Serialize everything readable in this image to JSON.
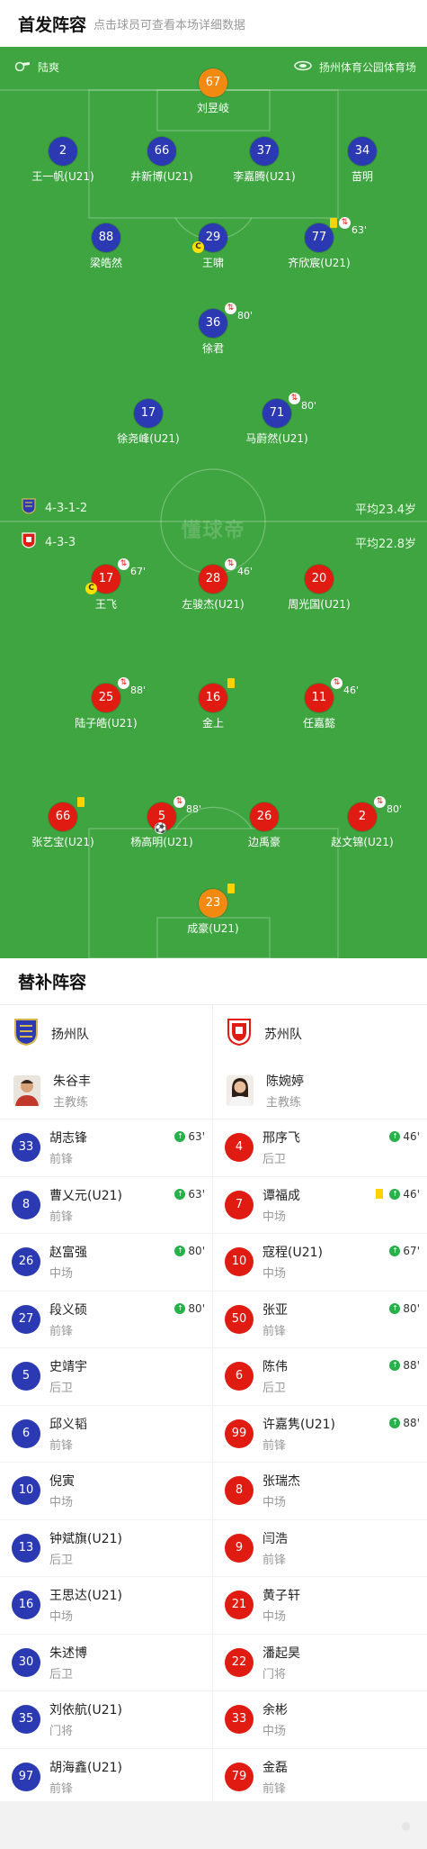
{
  "header": {
    "title": "首发阵容",
    "subtitle": "点击球员可查看本场详细数据"
  },
  "match": {
    "referee": "陆爽",
    "venue": "扬州体育公园体育场",
    "watermark": "懂球帝"
  },
  "home": {
    "formation": "4-3-1-2",
    "avg_age": "平均23.4岁",
    "team_name": "扬州队",
    "coach_name": "朱谷丰",
    "coach_role": "主教练",
    "players": [
      {
        "num": "67",
        "name": "刘昱岐",
        "kit": "gk"
      },
      {
        "num": "2",
        "name": "王一帆(U21)",
        "kit": "blue"
      },
      {
        "num": "66",
        "name": "井新博(U21)",
        "kit": "blue"
      },
      {
        "num": "37",
        "name": "李嘉腾(U21)",
        "kit": "blue"
      },
      {
        "num": "34",
        "name": "苗明",
        "kit": "blue"
      },
      {
        "num": "88",
        "name": "梁皓然",
        "kit": "blue"
      },
      {
        "num": "29",
        "name": "王啸",
        "kit": "blue",
        "captain": "C"
      },
      {
        "num": "77",
        "name": "齐欣宸(U21)",
        "kit": "blue",
        "yellow": true,
        "sub": "63'"
      },
      {
        "num": "36",
        "name": "徐君",
        "kit": "blue",
        "sub": "80'"
      },
      {
        "num": "17",
        "name": "徐尧峰(U21)",
        "kit": "blue"
      },
      {
        "num": "71",
        "name": "马蔚然(U21)",
        "kit": "blue",
        "sub": "80'"
      }
    ],
    "subs": [
      {
        "num": "33",
        "name": "胡志锋",
        "pos": "前锋",
        "time": "63'"
      },
      {
        "num": "8",
        "name": "曹乂元(U21)",
        "pos": "前锋",
        "time": "63'"
      },
      {
        "num": "26",
        "name": "赵富强",
        "pos": "中场",
        "time": "80'"
      },
      {
        "num": "27",
        "name": "段义硕",
        "pos": "前锋",
        "time": "80'"
      },
      {
        "num": "5",
        "name": "史靖宇",
        "pos": "后卫"
      },
      {
        "num": "6",
        "name": "邱义韬",
        "pos": "前锋"
      },
      {
        "num": "10",
        "name": "倪寅",
        "pos": "中场"
      },
      {
        "num": "13",
        "name": "钟斌旗(U21)",
        "pos": "后卫"
      },
      {
        "num": "16",
        "name": "王思达(U21)",
        "pos": "中场"
      },
      {
        "num": "30",
        "name": "朱述博",
        "pos": "后卫"
      },
      {
        "num": "35",
        "name": "刘依航(U21)",
        "pos": "门将"
      },
      {
        "num": "97",
        "name": "胡海鑫(U21)",
        "pos": "前锋"
      }
    ]
  },
  "away": {
    "formation": "4-3-3",
    "avg_age": "平均22.8岁",
    "team_name": "苏州队",
    "coach_name": "陈婉婷",
    "coach_role": "主教练",
    "players": [
      {
        "num": "17",
        "name": "王飞",
        "kit": "red",
        "captain": "C",
        "sub": "67'"
      },
      {
        "num": "28",
        "name": "左骏杰(U21)",
        "kit": "red",
        "sub": "46'"
      },
      {
        "num": "20",
        "name": "周光国(U21)",
        "kit": "red"
      },
      {
        "num": "25",
        "name": "陆子皓(U21)",
        "kit": "red",
        "sub": "88'"
      },
      {
        "num": "16",
        "name": "金上",
        "kit": "red",
        "yellow": true
      },
      {
        "num": "11",
        "name": "任嘉懿",
        "kit": "red",
        "sub": "46'"
      },
      {
        "num": "66",
        "name": "张艺宝(U21)",
        "kit": "red",
        "yellow": true
      },
      {
        "num": "5",
        "name": "杨高明(U21)",
        "kit": "red",
        "sub": "88'",
        "goal": true
      },
      {
        "num": "26",
        "name": "边禹豪",
        "kit": "red"
      },
      {
        "num": "2",
        "name": "赵文锦(U21)",
        "kit": "red",
        "sub": "80'"
      },
      {
        "num": "23",
        "name": "成豪(U21)",
        "kit": "gk",
        "yellow": true
      }
    ],
    "subs": [
      {
        "num": "4",
        "name": "邢序飞",
        "pos": "后卫",
        "time": "46'"
      },
      {
        "num": "7",
        "name": "谭福成",
        "pos": "中场",
        "time": "46'",
        "yellow": true
      },
      {
        "num": "10",
        "name": "寇程(U21)",
        "pos": "中场",
        "time": "67'"
      },
      {
        "num": "50",
        "name": "张亚",
        "pos": "前锋",
        "time": "80'"
      },
      {
        "num": "6",
        "name": "陈伟",
        "pos": "后卫",
        "time": "88'"
      },
      {
        "num": "99",
        "name": "许嘉隽(U21)",
        "pos": "前锋",
        "time": "88'"
      },
      {
        "num": "8",
        "name": "张瑞杰",
        "pos": "中场"
      },
      {
        "num": "9",
        "name": "闫浩",
        "pos": "前锋"
      },
      {
        "num": "21",
        "name": "黄子轩",
        "pos": "中场"
      },
      {
        "num": "22",
        "name": "潘起昊",
        "pos": "门将"
      },
      {
        "num": "33",
        "name": "余彬",
        "pos": "中场"
      },
      {
        "num": "79",
        "name": "金磊",
        "pos": "前锋"
      }
    ]
  },
  "subs_section": {
    "title": "替补阵容"
  },
  "colors": {
    "pitch": "#3fa541",
    "home": "#2b3ab3",
    "away": "#e01b12",
    "gk": "#f28a12"
  }
}
